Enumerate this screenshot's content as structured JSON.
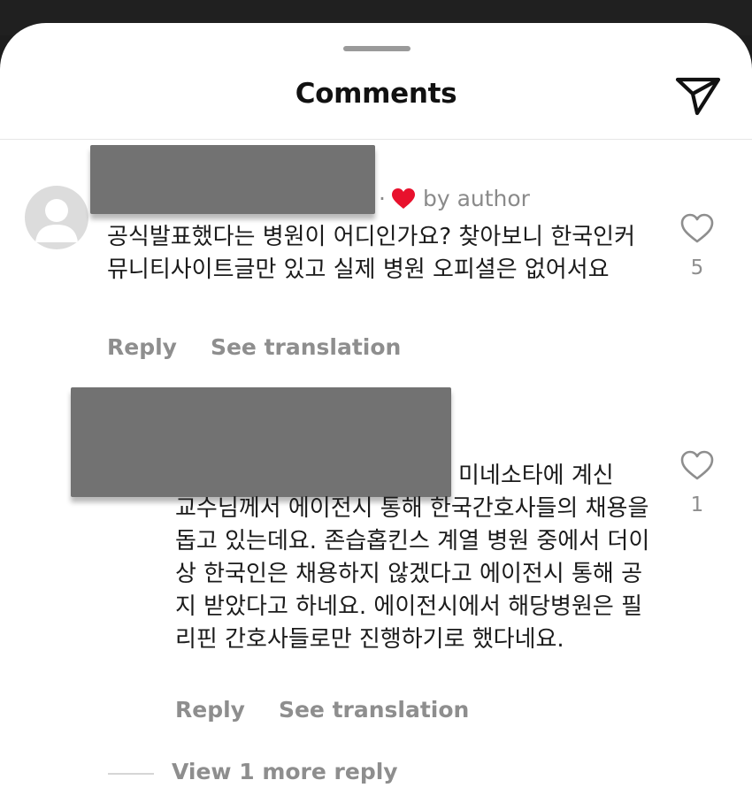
{
  "header": {
    "title": "Comments",
    "send_icon": "send-icon"
  },
  "comments": [
    {
      "meta_separator": "·",
      "author_like_label": "by author",
      "text": "공식발표했다는 병원이 어디인가요? 찾아보니 한국인커뮤니티사이트글만 있고 실제 병원 오피셜은 없어서요",
      "reply_label": "Reply",
      "translate_label": "See translation",
      "like_count": "5"
    },
    {
      "lead_text": "미네소타에 계신",
      "text": "교수님께서 에이전시 통해 한국간호사들의 채용을 돕고 있는데요. 존습홉킨스 계열 병원 중에서 더이상 한국인은 채용하지 않겠다고 에이전시 통해 공지 받았다고 하네요. 에이전시에서 해당병원은 필리핀 간호사들로만 진행하기로 했다네요.",
      "reply_label": "Reply",
      "translate_label": "See translation",
      "like_count": "1",
      "view_more_label": "View 1 more reply"
    }
  ],
  "colors": {
    "author_heart": "#e8112d",
    "muted_text": "#8e8e8e",
    "redaction": "#727272"
  }
}
